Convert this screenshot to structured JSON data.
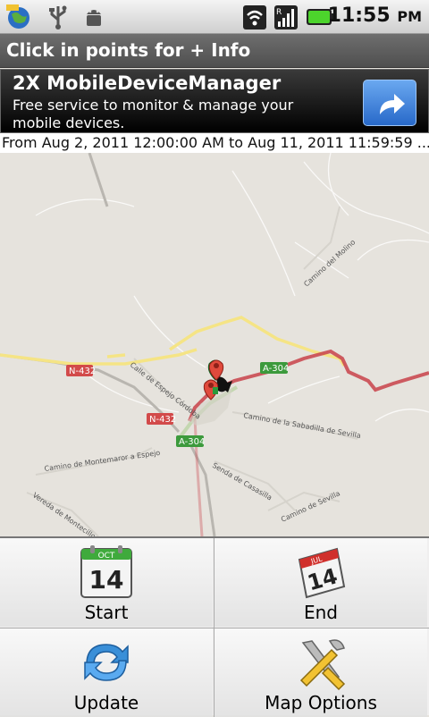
{
  "status_bar": {
    "time": "11:55",
    "ampm": "PM",
    "icons": [
      "app-globe-icon",
      "usb-icon",
      "android-debug-icon",
      "wifi-icon",
      "signal-icon",
      "battery-icon"
    ]
  },
  "title_bar": {
    "title": "Click in points for + Info"
  },
  "ad": {
    "title": "2X MobileDeviceManager",
    "text": "Free service to monitor & manage your mobile devices.",
    "button_icon": "share-arrow-icon"
  },
  "date_range": {
    "text": "From Aug 2, 2011 12:00:00 AM to Aug 11, 2011 11:59:59 ..."
  },
  "map": {
    "road_labels": {
      "n432_a": "N-432",
      "n432_b": "N-432",
      "a304_a": "A-304",
      "a304_b": "A-304",
      "camino_molino": "Camino del Molino",
      "calle_espejo": "Calle de Espejo Córdoba",
      "camino_sabadilla": "Camino de la Sabadilla de Sevilla",
      "camino_montemaror": "Camino de Montemaror a Espejo",
      "senda_casasilla": "Senda de Casasilla",
      "vereda": "Vereda de Montecillo",
      "camino_sevilla": "Camino de Sevilla"
    },
    "colors": {
      "route": "#c8424a",
      "road_yellow": "#f3e27a",
      "road_gray": "#b8b8b8",
      "highway_badge": "#3c9a3c",
      "national_badge": "#d24a4a"
    }
  },
  "menu": {
    "start": "Start",
    "end": "End",
    "update": "Update",
    "map_options": "Map Options",
    "calendar_month": "OCT",
    "calendar_day": "14",
    "calendar_month_end": "JUL",
    "calendar_day_end": "14"
  }
}
